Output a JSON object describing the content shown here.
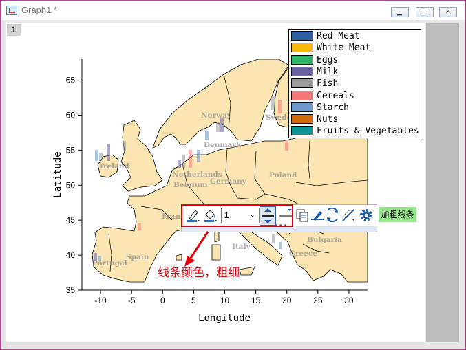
{
  "window": {
    "title": "Graph1 *",
    "layer_label": "1"
  },
  "chart_data": {
    "type": "map",
    "xlabel": "Longitude",
    "ylabel": "Latitude",
    "xlim": [
      -13,
      33
    ],
    "ylim": [
      35,
      68
    ],
    "xticks": [
      -10,
      -5,
      0,
      5,
      10,
      15,
      20,
      25,
      30
    ],
    "yticks": [
      35,
      40,
      45,
      50,
      55,
      60,
      65
    ],
    "xtick_labels": [
      "-10",
      "-5",
      "0",
      "5",
      "10",
      "15",
      "20",
      "25",
      "30"
    ],
    "ytick_labels": [
      "35",
      "40",
      "45",
      "50",
      "55",
      "60",
      "65"
    ],
    "country_labels": [
      "Norway",
      "Sweden",
      "Denmark",
      "Ireland",
      "Netherlands",
      "Belgium",
      "Germany",
      "Poland",
      "France",
      "Spain",
      "Portugal",
      "Italy",
      "Bulgaria",
      "Greece"
    ],
    "legend": {
      "placement": "top-right",
      "entries": [
        {
          "label": "Red Meat",
          "color": "#2e5fa0"
        },
        {
          "label": "White Meat",
          "color": "#f9b80b"
        },
        {
          "label": "Eggs",
          "color": "#2fb567"
        },
        {
          "label": "Milk",
          "color": "#6b63a5"
        },
        {
          "label": "Fish",
          "color": "#9a9a9a"
        },
        {
          "label": "Cereals",
          "color": "#f77777"
        },
        {
          "label": "Starch",
          "color": "#6d97c9"
        },
        {
          "label": "Nuts",
          "color": "#d26a0c"
        },
        {
          "label": "Fruits & Vegetables",
          "color": "#0c9596"
        }
      ]
    }
  },
  "toolbar": {
    "icons": [
      "line-color-icon",
      "fill-color-icon",
      "line-width-icon",
      "line-style-icon",
      "copy-format-icon",
      "pen-icon",
      "expand-icon",
      "rotate-icon",
      "line-plot-icon",
      "settings-icon"
    ],
    "line_width_value": "1",
    "hint_label": "加粗线条"
  },
  "annotation": {
    "text": "线条颜色，粗细"
  },
  "colors": {
    "land": "#fbe6b3",
    "accent_red": "#e8000c",
    "hint_bg": "#98e38e"
  }
}
